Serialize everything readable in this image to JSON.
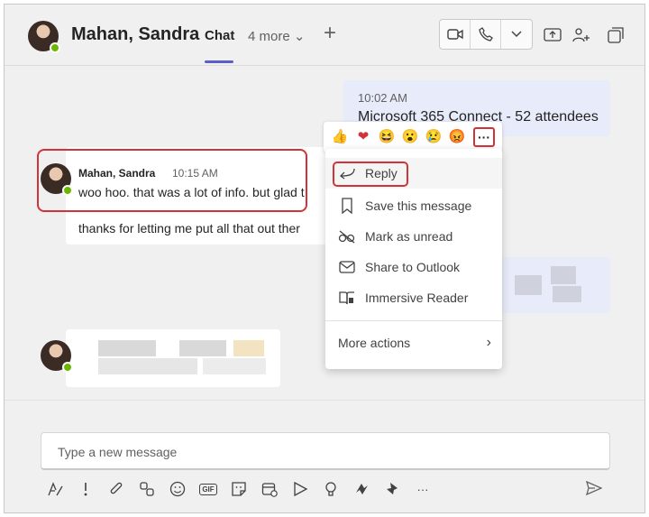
{
  "header": {
    "contact_name": "Mahan, Sandra",
    "tab_chat": "Chat",
    "tab_more": "4 more ⌄",
    "add_tab": "+"
  },
  "messages": {
    "right": {
      "time": "10:02 AM",
      "title": "Microsoft 365 Connect - 52 attendees"
    },
    "left": {
      "sender": "Mahan, Sandra",
      "time": "10:15 AM",
      "line1": "woo hoo. that was a lot of info. but glad t",
      "line2": "thanks for letting me put all that out ther"
    }
  },
  "reactions": [
    "👍",
    "❤",
    "😆",
    "😮",
    "😢",
    "😡"
  ],
  "reaction_more": "···",
  "context_menu": {
    "items": [
      {
        "label": "Reply",
        "icon": "reply-icon"
      },
      {
        "label": "Save this message",
        "icon": "bookmark-icon"
      },
      {
        "label": "Mark as unread",
        "icon": "unread-icon"
      },
      {
        "label": "Share to Outlook",
        "icon": "mail-icon"
      },
      {
        "label": "Immersive Reader",
        "icon": "immersive-reader-icon"
      }
    ],
    "more_actions": "More actions",
    "chevron": "›"
  },
  "compose": {
    "placeholder": "Type a new message"
  },
  "toolbar": {
    "more": "···",
    "gif": "GIF"
  },
  "colors": {
    "accent": "#5b5fc7",
    "highlight": "#d13438",
    "presence": "#6bb700",
    "bubble_self": "#e8ebfa"
  }
}
